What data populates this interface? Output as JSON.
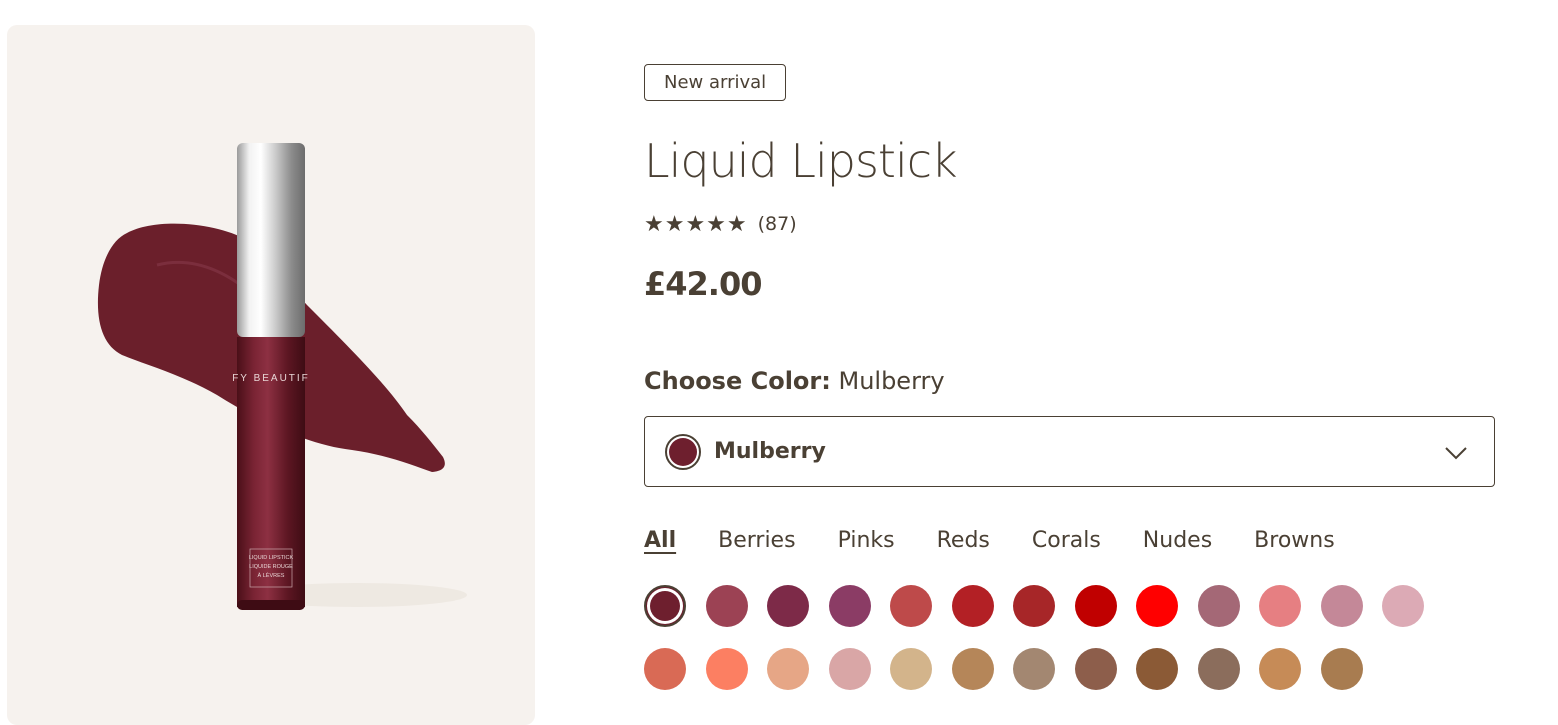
{
  "product": {
    "badge": "New arrival",
    "title": "Liquid Lipstick",
    "rating": {
      "stars_display": "★★★★★",
      "value_out_of_5": 5,
      "count_label": "(87)"
    },
    "price": "£42.00",
    "image": {
      "brand_text": "FY BEAUTIF",
      "tube_label": [
        "LIQUID LIPSTICK",
        "LIQUIDE ROUGE",
        "À LÈVRES"
      ]
    }
  },
  "color_picker": {
    "heading_label": "Choose Color:",
    "heading_value": "Mulberry",
    "dropdown": {
      "selected_label": "Mulberry",
      "selected_color": "#6e1f2e"
    },
    "filters": [
      "All",
      "Berries",
      "Pinks",
      "Reds",
      "Corals",
      "Nudes",
      "Browns"
    ],
    "active_filter": "All",
    "swatches": [
      "#6e1f2e",
      "#9c4254",
      "#7d2a48",
      "#8b3c65",
      "#be4a4a",
      "#b32025",
      "#a72628",
      "#c00000",
      "#ff0000",
      "#a46876",
      "#e67f82",
      "#c48898",
      "#dcaab5",
      "#d96a55",
      "#fc7f62",
      "#e6a686",
      "#d9a6a6",
      "#d3b48b",
      "#b58659",
      "#a38771",
      "#8d5e4b",
      "#8b5a36",
      "#8b6d5c",
      "#c68b57",
      "#a87c50"
    ],
    "selected_index": 0
  },
  "colors": {
    "text": "#4a4034",
    "gallery_bg": "#f6f2ee",
    "product_wine": "#6b1f2b"
  }
}
